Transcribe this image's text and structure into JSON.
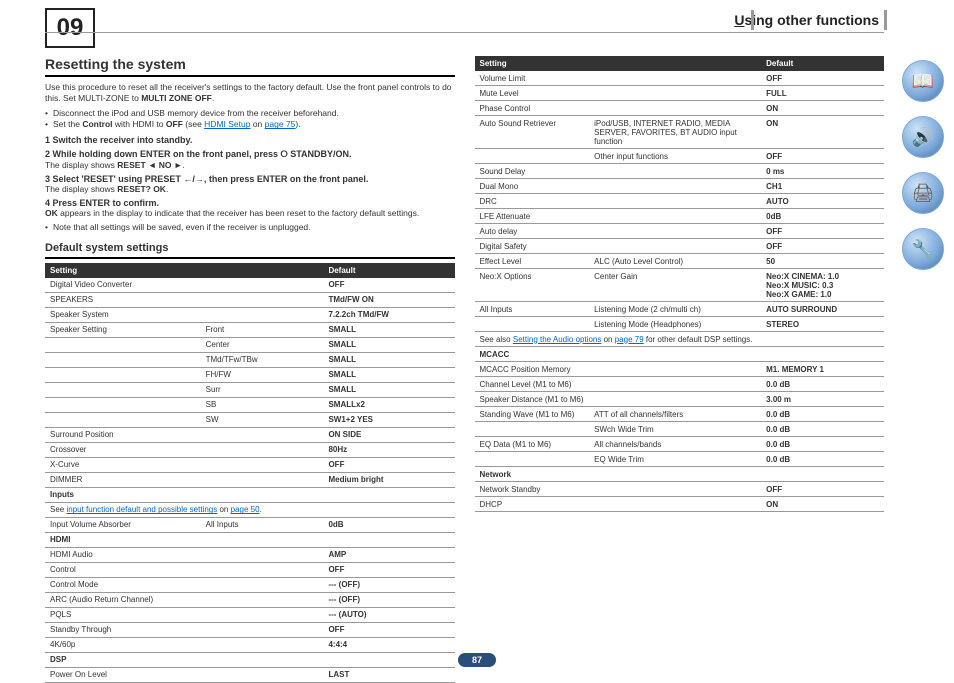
{
  "chapter": "09",
  "header": "sing other functions",
  "header_u": "U",
  "page": "87",
  "side_icons": [
    "📖",
    "🔊",
    "🖨",
    "🔧"
  ],
  "s1": {
    "title": "Resetting the system",
    "intro": "Use this procedure to reset all the receiver's settings to the factory default. Use the front panel controls to do this. Set MULTI-ZONE to ",
    "intro_b": "MULTI ZONE OFF",
    "b1": "Disconnect the iPod and USB memory device from the receiver beforehand.",
    "b2a": "Set the ",
    "b2b": "Control",
    "b2c": " with HDMI to ",
    "b2d": "OFF",
    "b2e": " (see ",
    "b2link": "HDMI Setup",
    "b2f": " on ",
    "b2pg": "page 75",
    "b2g": ").",
    "st1": "1   Switch the receiver into standby.",
    "st2": "2   While holding down ENTER on the front panel, press ⭘ STANDBY/ON.",
    "st2n_a": "The display shows ",
    "st2n_b": "RESET ◄ NO ►",
    "st3": "3   Select 'RESET' using PRESET ←/→, then press ENTER on the front panel.",
    "st3n_a": "The display shows ",
    "st3n_b": "RESET? OK",
    "st4": "4   Press ENTER to confirm.",
    "ok_a": "OK",
    "ok_b": " appears in the display to indicate that the receiver has been reset to the factory default settings.",
    "note": "Note that all settings will be saved, even if the receiver is unplugged."
  },
  "s2": {
    "title": "Default system settings",
    "th1": "Setting",
    "th2": "Default",
    "sh_inputs": "Inputs",
    "sh_hdmi": "HDMI",
    "sh_dsp": "DSP",
    "sh_mcacc": "MCACC",
    "sh_network": "Network",
    "foot1a": "See ",
    "foot1b": "input function default and possible settings",
    "foot1c": " on ",
    "foot1d": "page 50",
    "foot2a": "See also ",
    "foot2b": "Setting the Audio options",
    "foot2c": " on ",
    "foot2d": "page 79",
    "foot2e": " for other default DSP settings.",
    "left_rows": [
      [
        "Digital Video Converter",
        "",
        "OFF"
      ],
      [
        "SPEAKERS",
        "",
        "TMd/FW ON"
      ],
      [
        "Speaker System",
        "",
        "7.2.2ch TMd/FW"
      ],
      [
        "Speaker Setting",
        "Front",
        "SMALL"
      ],
      [
        "",
        "Center",
        "SMALL"
      ],
      [
        "",
        "TMd/TFw/TBw",
        "SMALL"
      ],
      [
        "",
        "FH/FW",
        "SMALL"
      ],
      [
        "",
        "Surr",
        "SMALL"
      ],
      [
        "",
        "SB",
        "SMALLx2"
      ],
      [
        "",
        "SW",
        "SW1+2 YES"
      ],
      [
        "Surround Position",
        "",
        "ON SIDE"
      ],
      [
        "Crossover",
        "",
        "80Hz"
      ],
      [
        "X-Curve",
        "",
        "OFF"
      ],
      [
        "DIMMER",
        "",
        "Medium bright"
      ]
    ],
    "inputs_rows": [
      [
        "Input Volume Absorber",
        "All Inputs",
        "0dB"
      ]
    ],
    "hdmi_rows": [
      [
        "HDMI Audio",
        "",
        "AMP"
      ],
      [
        "Control",
        "",
        "OFF"
      ],
      [
        "Control Mode",
        "",
        "--- (OFF)"
      ],
      [
        "ARC (Audio Return Channel)",
        "",
        "--- (OFF)"
      ],
      [
        "PQLS",
        "",
        "--- (AUTO)"
      ],
      [
        "Standby Through",
        "",
        "OFF"
      ],
      [
        "4K/60p",
        "",
        "4:4:4"
      ]
    ],
    "dsp_rows": [
      [
        "Power On Level",
        "",
        "LAST"
      ]
    ],
    "right_rows": [
      [
        "Volume Limit",
        "",
        "OFF"
      ],
      [
        "Mute Level",
        "",
        "FULL"
      ],
      [
        "Phase Control",
        "",
        "ON"
      ],
      [
        "Auto Sound Retriever",
        "iPod/USB, INTERNET RADIO, MEDIA SERVER, FAVORITES, BT AUDIO input function",
        "ON"
      ],
      [
        "",
        "Other input functions",
        "OFF"
      ],
      [
        "Sound Delay",
        "",
        "0 ms"
      ],
      [
        "Dual Mono",
        "",
        "CH1"
      ],
      [
        "DRC",
        "",
        "AUTO"
      ],
      [
        "LFE Attenuate",
        "",
        "0dB"
      ],
      [
        "Auto delay",
        "",
        "OFF"
      ],
      [
        "Digital Safety",
        "",
        "OFF"
      ],
      [
        "Effect Level",
        "ALC (Auto Level Control)",
        "50"
      ],
      [
        "Neo:X Options",
        "Center Gain",
        "Neo:X CINEMA: 1.0\nNeo:X MUSIC: 0.3\nNeo:X GAME: 1.0"
      ],
      [
        "All Inputs",
        "Listening Mode (2 ch/multi ch)",
        "AUTO SURROUND"
      ],
      [
        "",
        "Listening Mode (Headphones)",
        "STEREO"
      ]
    ],
    "mcacc_rows": [
      [
        "MCACC Position Memory",
        "",
        "M1. MEMORY 1"
      ],
      [
        "Channel Level (M1 to M6)",
        "",
        "0.0 dB"
      ],
      [
        "Speaker Distance (M1 to M6)",
        "",
        "3.00 m"
      ],
      [
        "Standing Wave (M1 to M6)",
        "ATT of all channels/filters",
        "0.0 dB"
      ],
      [
        "",
        "SWch Wide Trim",
        "0.0 dB"
      ],
      [
        "EQ Data (M1 to M6)",
        "All channels/bands",
        "0.0 dB"
      ],
      [
        "",
        "EQ Wide Trim",
        "0.0 dB"
      ]
    ],
    "network_rows": [
      [
        "Network Standby",
        "",
        "OFF"
      ],
      [
        "DHCP",
        "",
        "ON"
      ]
    ]
  }
}
